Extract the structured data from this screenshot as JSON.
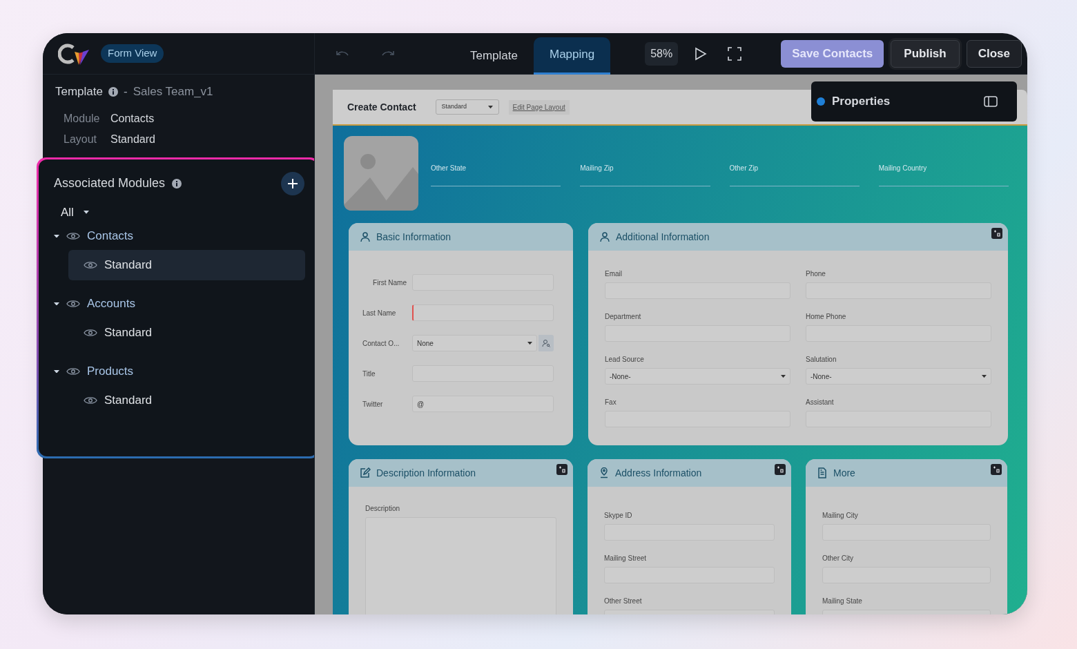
{
  "header": {
    "badge": "Form View"
  },
  "sidebar": {
    "template_label": "Template",
    "separator": "-",
    "template_name": "Sales Team_v1",
    "meta": [
      {
        "label": "Module",
        "value": "Contacts"
      },
      {
        "label": "Layout",
        "value": "Standard"
      }
    ],
    "associated": {
      "title": "Associated Modules",
      "filter": "All",
      "modules": [
        {
          "name": "Contacts",
          "expanded": true,
          "children": [
            {
              "name": "Standard",
              "selected": true
            }
          ]
        },
        {
          "name": "Accounts",
          "expanded": true,
          "children": [
            {
              "name": "Standard",
              "selected": false
            }
          ]
        },
        {
          "name": "Products",
          "expanded": true,
          "children": [
            {
              "name": "Standard",
              "selected": false
            }
          ]
        }
      ]
    }
  },
  "toolbar": {
    "tabs": [
      {
        "label": "Template",
        "selected": false
      },
      {
        "label": "Mapping",
        "selected": true
      }
    ],
    "zoom": "58%",
    "buttons": [
      {
        "label": "Save Contacts",
        "kind": "primary"
      },
      {
        "label": "Publish",
        "kind": "secondary"
      },
      {
        "label": "Close",
        "kind": "plain"
      }
    ]
  },
  "form": {
    "title": "Create Contact",
    "layout_select": "Standard",
    "link": "Edit Page Layout",
    "top_fields": [
      "Other State",
      "Mailing Zip",
      "Other Zip",
      "Mailing Country"
    ],
    "sections": [
      {
        "title": "Basic Information",
        "kind": "inline",
        "action": false,
        "fields": [
          {
            "label": "First Name",
            "kind": "text",
            "required": false
          },
          {
            "label": "Last Name",
            "kind": "text",
            "required": true
          },
          {
            "label": "Contact O...",
            "kind": "lookup",
            "value": "None",
            "required": false
          },
          {
            "label": "Title",
            "kind": "text",
            "required": false
          },
          {
            "label": "Twitter",
            "kind": "text",
            "value": "@",
            "required": false
          }
        ]
      },
      {
        "title": "Additional Information",
        "kind": "stacked",
        "action": true,
        "fields": [
          {
            "label": "Email",
            "kind": "text",
            "required": false
          },
          {
            "label": "Phone",
            "kind": "text",
            "required": false
          },
          {
            "label": "Department",
            "kind": "text",
            "required": false
          },
          {
            "label": "Home Phone",
            "kind": "text",
            "required": false
          },
          {
            "label": "Lead Source",
            "kind": "select",
            "value": "-None-",
            "required": false
          },
          {
            "label": "Salutation",
            "kind": "select",
            "value": "-None-",
            "required": false
          },
          {
            "label": "Fax",
            "kind": "text",
            "required": false
          },
          {
            "label": "Assistant",
            "kind": "text",
            "required": false
          }
        ]
      },
      {
        "title": "Description Information",
        "kind": "stacked",
        "action": true,
        "fields": [
          {
            "label": "Description",
            "kind": "textarea",
            "required": false
          }
        ]
      },
      {
        "title": "Address Information",
        "kind": "stacked",
        "action": true,
        "fields": [
          {
            "label": "Skype ID",
            "kind": "text",
            "required": false
          },
          {
            "label": "Mailing Street",
            "kind": "text",
            "required": false
          },
          {
            "label": "Other Street",
            "kind": "text",
            "required": false
          }
        ]
      },
      {
        "title": "More",
        "kind": "stacked",
        "action": true,
        "fields": [
          {
            "label": "Mailing City",
            "kind": "text",
            "required": false
          },
          {
            "label": "Other City",
            "kind": "text",
            "required": false
          },
          {
            "label": "Mailing State",
            "kind": "text",
            "required": false
          }
        ]
      }
    ]
  },
  "properties": {
    "title": "Properties"
  }
}
